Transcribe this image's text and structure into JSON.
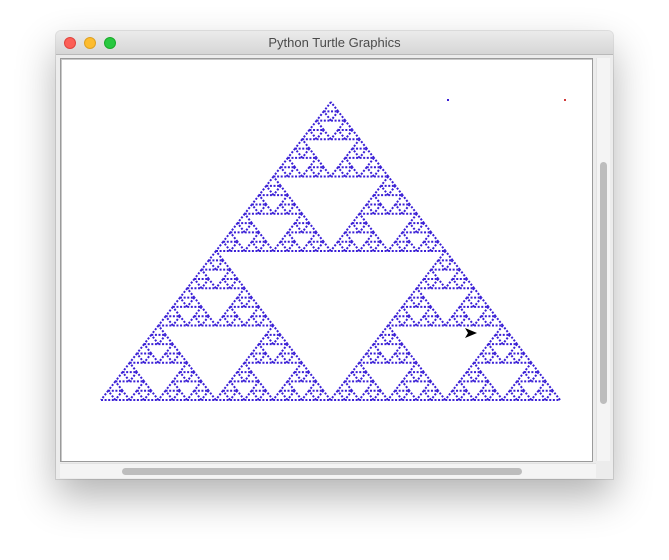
{
  "window": {
    "title": "Python Turtle Graphics"
  },
  "colors": {
    "pen": "#3a1fd6",
    "stray_dot_1": "#3a1fd6",
    "stray_dot_2": "#d23a3a",
    "cursor": "#000000"
  },
  "icons": {
    "close": "close-icon",
    "minimize": "minimize-icon",
    "zoom": "zoom-icon",
    "turtle_cursor": "arrow-cursor-icon"
  },
  "drawing": {
    "shape": "sierpinski-triangle",
    "fractal_depth": 5
  }
}
